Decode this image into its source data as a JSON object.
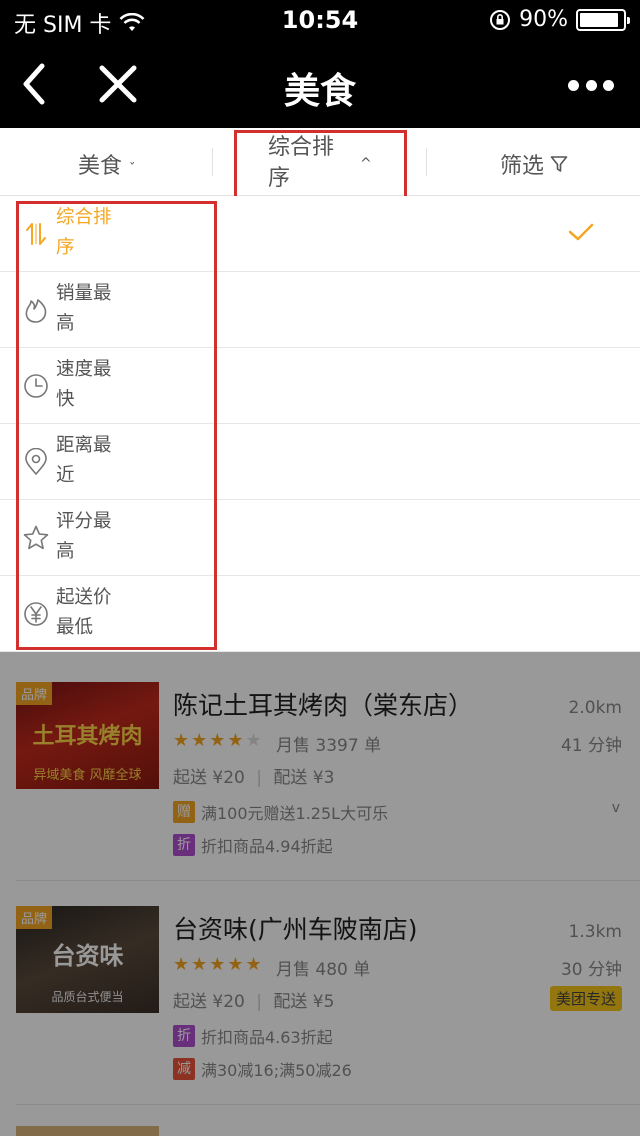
{
  "status_bar": {
    "carrier": "无 SIM 卡",
    "time": "10:54",
    "battery": "90%",
    "battery_level": 0.9
  },
  "nav": {
    "title": "美食"
  },
  "filter_bar": {
    "category_label": "美食",
    "sort_label": "综合排序",
    "filter_label": "筛选"
  },
  "sort_options": [
    {
      "label": "综合排序",
      "icon": "sort-arrows-icon",
      "selected": true
    },
    {
      "label": "销量最高",
      "icon": "flame-icon",
      "selected": false
    },
    {
      "label": "速度最快",
      "icon": "clock-icon",
      "selected": false
    },
    {
      "label": "距离最近",
      "icon": "location-pin-icon",
      "selected": false
    },
    {
      "label": "评分最高",
      "icon": "star-icon",
      "selected": false
    },
    {
      "label": "起送价最低",
      "icon": "yen-icon",
      "selected": false
    }
  ],
  "restaurants": [
    {
      "brand_tag": "品牌",
      "thumb_text": "土耳其烤肉",
      "thumb_subtext": "异域美食 风靡全球",
      "name": "陈记土耳其烤肉（棠东店）",
      "rating": 4.5,
      "sales": "月售 3397 单",
      "min_order": "起送 ¥20",
      "delivery_fee": "配送 ¥3",
      "distance": "2.0km",
      "eta": "41 分钟",
      "promos": [
        {
          "badge": "赠",
          "text": "满100元赠送1.25L大可乐",
          "color": "#f5a623"
        },
        {
          "badge": "折",
          "text": "折扣商品4.94折起",
          "color": "#b04fd0"
        }
      ]
    },
    {
      "brand_tag": "品牌",
      "thumb_text": "台资味",
      "thumb_subtext": "品质台式便当",
      "name": "台资味(广州车陂南店)",
      "rating": 5,
      "sales": "月售 480 单",
      "min_order": "起送 ¥20",
      "delivery_fee": "配送 ¥5",
      "distance": "1.3km",
      "eta": "30 分钟",
      "delivery_badge": "美团专送",
      "promos": [
        {
          "badge": "折",
          "text": "折扣商品4.63折起",
          "color": "#b04fd0"
        },
        {
          "badge": "减",
          "text": "满30减16;满50减26",
          "color": "#e8543a"
        }
      ]
    }
  ],
  "colors": {
    "accent": "#f5a623",
    "highlight_box": "#d32f2f",
    "nav_bg": "#000000"
  }
}
